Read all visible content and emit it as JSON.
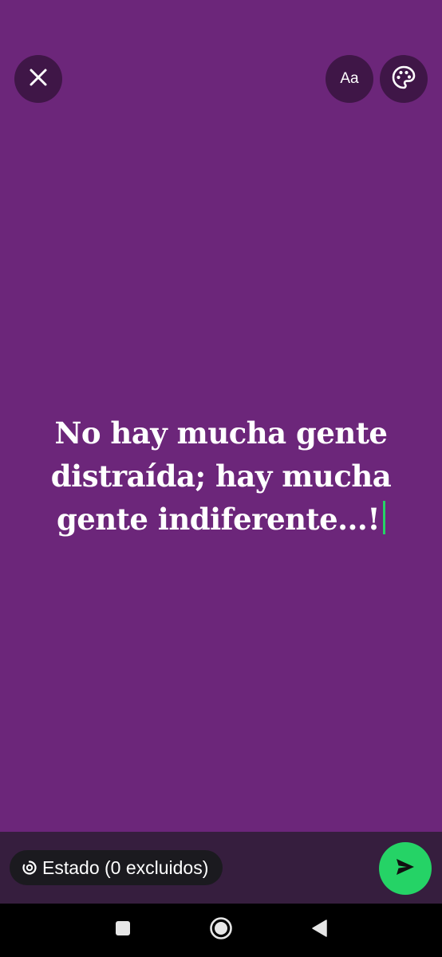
{
  "app": {
    "accent_color": "#25d366",
    "background_color": "#6c267a"
  },
  "top_bar": {
    "close_icon": "close-icon",
    "font_button_label": "Aa",
    "palette_icon": "palette-icon"
  },
  "status": {
    "text_line_1": "No hay mucha gente",
    "text_line_2": "distraída; hay mucha",
    "text_line_3": "gente indiferente...!"
  },
  "bottom_bar": {
    "audience_label": "Estado (0 excluidos)",
    "audience_icon": "status-ring-icon",
    "send_icon": "send-icon"
  },
  "navigation": {
    "recents_icon": "square-icon",
    "home_icon": "circle-icon",
    "back_icon": "triangle-back-icon"
  }
}
